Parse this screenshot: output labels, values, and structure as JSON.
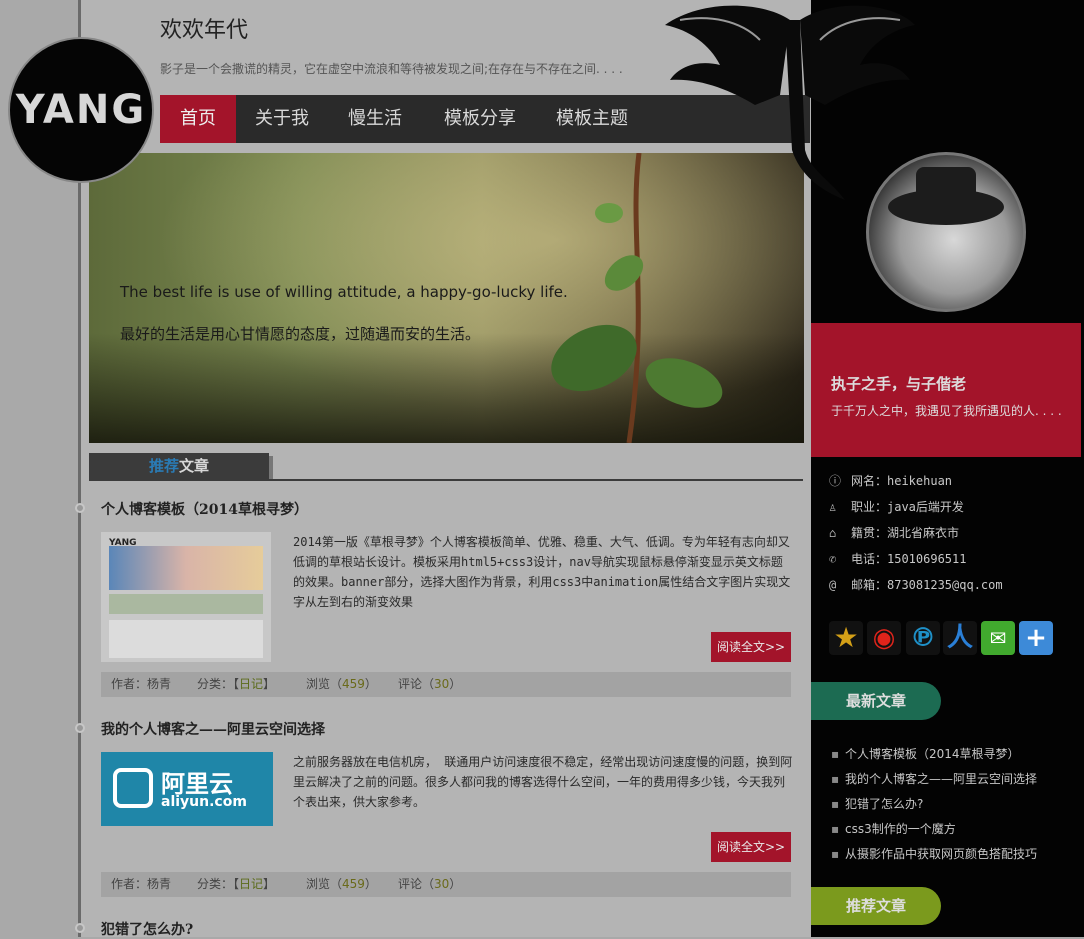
{
  "header": {
    "site_title": "欢欢年代",
    "site_subtitle": "影子是一个会撒谎的精灵，它在虚空中流浪和等待被发现之间;在存在与不存在之间. . . .",
    "logo_text": "YANG"
  },
  "nav": {
    "items": [
      {
        "label": "首页",
        "active": true
      },
      {
        "label": "关于我",
        "active": false
      },
      {
        "label": "慢生活",
        "active": false
      },
      {
        "label": "模板分享",
        "active": false
      },
      {
        "label": "模板主题",
        "active": false
      }
    ]
  },
  "banner": {
    "english": "The best life is use of willing attitude, a happy-go-lucky life.",
    "chinese": "最好的生活是用心甘情愿的态度，过随遇而安的生活。"
  },
  "section": {
    "highlight": "推荐",
    "rest": "文章"
  },
  "articles": [
    {
      "title": "个人博客模板（2014草根寻梦）",
      "text": "2014第一版《草根寻梦》个人博客模板简单、优雅、稳重、大气、低调。专为年轻有志向却又低调的草根站长设计。模板采用html5+css3设计，nav导航实现鼠标悬停渐变显示英文标题的效果。banner部分，选择大图作为背景，利用css3中animation属性结合文字图片实现文字从左到右的渐变效果",
      "read_more": "阅读全文>>",
      "author_label": "作者：杨青",
      "category_prefix": "分类：【",
      "category": "日记",
      "category_suffix": "】",
      "views_prefix": "浏览（",
      "views": "459",
      "views_suffix": "）",
      "comments_prefix": "评论（",
      "comments": "30",
      "comments_suffix": "）"
    },
    {
      "title": "我的个人博客之——阿里云空间选择",
      "text": "之前服务器放在电信机房， 联通用户访问速度很不稳定，经常出现访问速度慢的问题，换到阿里云解决了之前的问题。很多人都问我的博客选得什么空间，一年的费用得多少钱，今天我列个表出来，供大家参考。",
      "read_more": "阅读全文>>",
      "author_label": "作者：杨青",
      "category_prefix": "分类：【",
      "category": "日记",
      "category_suffix": "】",
      "views_prefix": "浏览（",
      "views": "459",
      "views_suffix": "）",
      "comments_prefix": "评论（",
      "comments": "30",
      "comments_suffix": "）"
    },
    {
      "title": "犯错了怎么办?"
    }
  ],
  "thumb2": {
    "logo_cn": "阿里云",
    "logo_en": "aliyun.com"
  },
  "thumb1": {
    "logo": "YANG"
  },
  "sidebar": {
    "motto_title": "执子之手，与子偕老",
    "motto_sub": "于千万人之中，我遇见了我所遇见的人. . . .",
    "info": [
      {
        "icon": "info-icon",
        "glyph": "ⓘ",
        "text": "网名：heikehuan"
      },
      {
        "icon": "user-icon",
        "glyph": "♙",
        "text": "职业：java后端开发"
      },
      {
        "icon": "home-icon",
        "glyph": "⌂",
        "text": "籍贯：湖北省麻衣市"
      },
      {
        "icon": "phone-icon",
        "glyph": "✆",
        "text": "电话：15010696511"
      },
      {
        "icon": "email-icon",
        "glyph": "@",
        "text": "邮箱：873081235@qq.com"
      }
    ],
    "latest_title": "最新文章",
    "latest": [
      "个人博客模板（2014草根寻梦）",
      "我的个人博客之——阿里云空间选择",
      "犯错了怎么办?",
      "css3制作的一个魔方",
      "从摄影作品中获取网页颜色搭配技巧"
    ],
    "recommend_title": "推荐文章"
  },
  "colors": {
    "accent_red": "#a3142a",
    "latest_pill": "#1c6b52",
    "recommend_pill": "#7b9a1d"
  }
}
